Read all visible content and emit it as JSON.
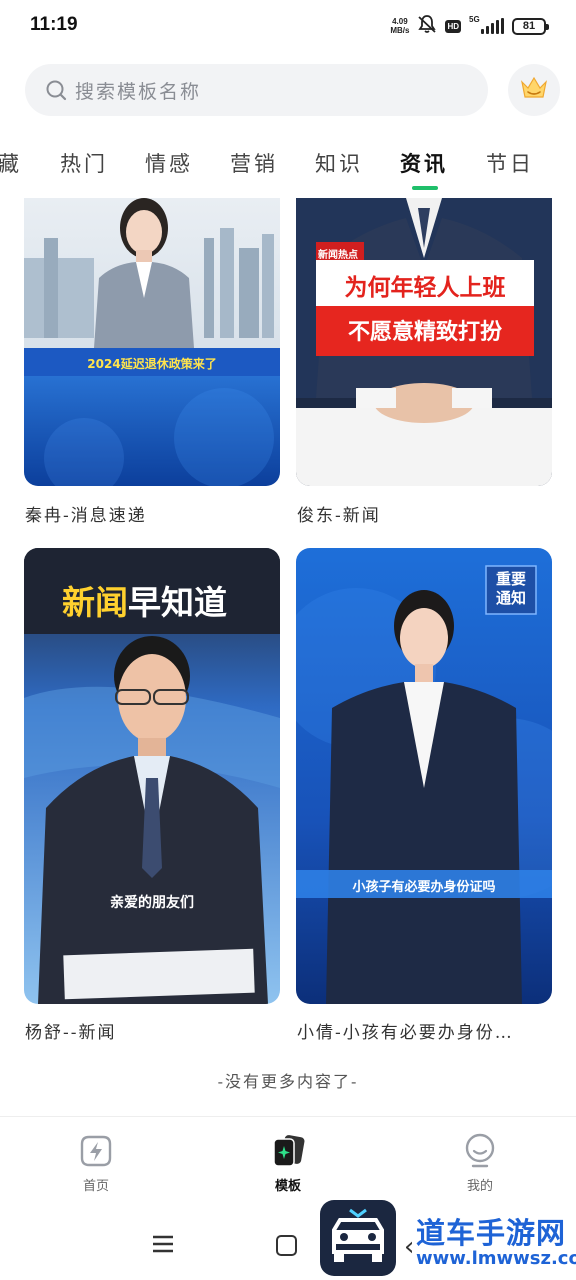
{
  "status_bar": {
    "time": "11:19",
    "net_speed_value": "4.09",
    "net_speed_unit": "MB/s",
    "hd": "HD",
    "network": "5G",
    "battery": "81"
  },
  "search": {
    "placeholder": "搜索模板名称"
  },
  "tabs": [
    {
      "label": "藏",
      "active": false
    },
    {
      "label": "热门",
      "active": false
    },
    {
      "label": "情感",
      "active": false
    },
    {
      "label": "营销",
      "active": false
    },
    {
      "label": "知识",
      "active": false
    },
    {
      "label": "资讯",
      "active": true
    },
    {
      "label": "节日",
      "active": false
    }
  ],
  "cards": [
    {
      "title": "秦冉-消息速递",
      "caption": "2024延迟退休政策来了"
    },
    {
      "title": "俊东-新闻",
      "tag": "新闻热点",
      "headline_line1": "为何年轻人上班",
      "headline_line2": "不愿意精致打扮"
    },
    {
      "title": "杨舒--新闻",
      "banner_part1": "新闻",
      "banner_part2": "早知道",
      "caption": "亲爱的朋友们"
    },
    {
      "title": "小倩-小孩有必要办身份…",
      "badge_line1": "重要",
      "badge_line2": "通知",
      "caption": "小孩子有必要办身份证吗"
    }
  ],
  "end_text": "-没有更多内容了-",
  "bottom_nav": [
    {
      "label": "首页",
      "icon": "lightning-icon",
      "active": false
    },
    {
      "label": "模板",
      "icon": "template-icon",
      "active": true
    },
    {
      "label": "我的",
      "icon": "profile-icon",
      "active": false
    }
  ],
  "watermark": {
    "title": "道车手游网",
    "url": "www.lmwwsz.com"
  },
  "colors": {
    "accent": "#1fbf6a",
    "search_bg": "#f2f3f5",
    "news_blue": "#1f5fb8",
    "watermark_blue": "#1e63d6"
  }
}
